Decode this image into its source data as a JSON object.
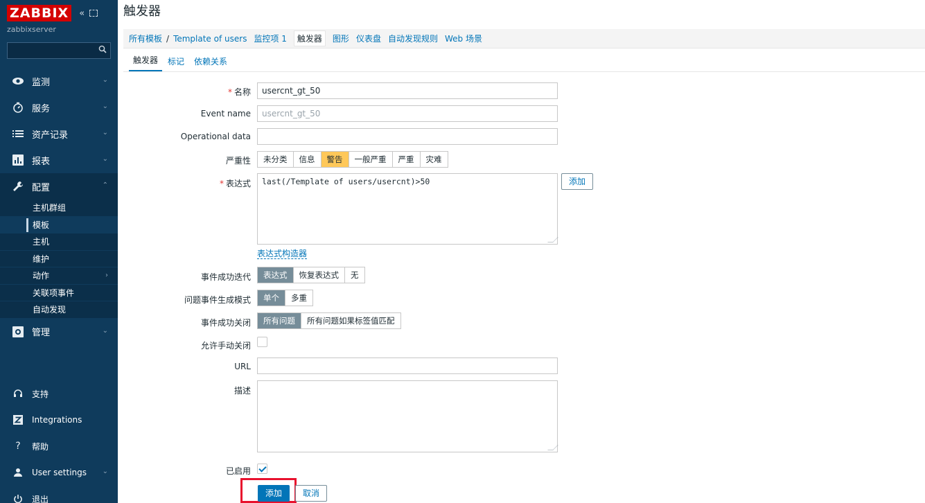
{
  "app": {
    "logo": "ZABBIX",
    "server_name": "zabbixserver",
    "page_title": "触发器"
  },
  "sidebar": {
    "search_placeholder": "",
    "menu": [
      {
        "label": "监测",
        "icon": "eye-icon"
      },
      {
        "label": "服务",
        "icon": "clock-icon"
      },
      {
        "label": "资产记录",
        "icon": "list-icon"
      },
      {
        "label": "报表",
        "icon": "bar-chart-icon"
      },
      {
        "label": "配置",
        "icon": "wrench-icon"
      }
    ],
    "config_submenu": [
      "主机群组",
      "模板",
      "主机",
      "维护",
      "动作",
      "关联项事件",
      "自动发现"
    ],
    "admin_label": "管理",
    "bottom": [
      {
        "label": "支持",
        "icon": "headset-icon"
      },
      {
        "label": "Integrations",
        "icon": "zabbix-z-icon"
      },
      {
        "label": "帮助",
        "icon": "question-icon"
      },
      {
        "label": "User settings",
        "icon": "user-icon"
      },
      {
        "label": "退出",
        "icon": "power-icon"
      }
    ]
  },
  "nav": {
    "all_templates": "所有模板",
    "separator": "/",
    "template": "Template of users",
    "items": "监控项 1",
    "triggers": "触发器",
    "graphs": "图形",
    "dashboards": "仪表盘",
    "discovery": "自动发现规则",
    "web": "Web 场景"
  },
  "tabs": [
    "触发器",
    "标记",
    "依赖关系"
  ],
  "form": {
    "name_label": "名称",
    "name_value": "usercnt_gt_50",
    "event_name_label": "Event name",
    "event_name_placeholder": "usercnt_gt_50",
    "opdata_label": "Operational data",
    "opdata_value": "",
    "severity_label": "严重性",
    "severities": [
      "未分类",
      "信息",
      "警告",
      "一般严重",
      "严重",
      "灾难"
    ],
    "severity_selected": "警告",
    "expression_label": "表达式",
    "expression_value": "last(/Template of users/usercnt)>50",
    "expression_add": "添加",
    "expression_builder": "表达式构造器",
    "ok_event_label": "事件成功迭代",
    "ok_event_options": [
      "表达式",
      "恢复表达式",
      "无"
    ],
    "problem_mode_label": "问题事件生成模式",
    "problem_mode_options": [
      "单个",
      "多重"
    ],
    "ok_close_label": "事件成功关闭",
    "ok_close_options": [
      "所有问题",
      "所有问题如果标签值匹配"
    ],
    "manual_close_label": "允许手动关闭",
    "url_label": "URL",
    "url_value": "",
    "description_label": "描述",
    "description_value": "",
    "enabled_label": "已启用",
    "submit": "添加",
    "cancel": "取消"
  },
  "colors": {
    "sidebar_bg": "#0f3b5c",
    "accent": "#0275b8",
    "warning": "#ffc859",
    "highlight": "#e8112d"
  }
}
